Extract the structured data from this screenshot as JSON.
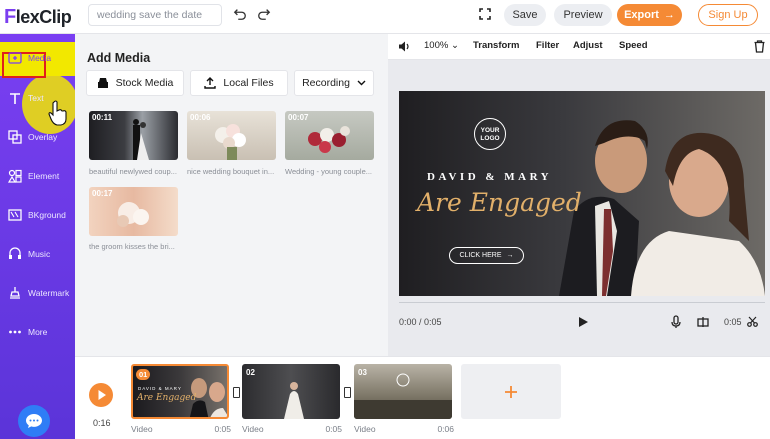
{
  "app": {
    "logo": "FlexClip"
  },
  "topbar": {
    "project_name": "wedding save the date",
    "save": "Save",
    "preview": "Preview",
    "export": "Export",
    "signup": "Sign Up"
  },
  "sidebar": {
    "items": [
      {
        "label": "Media",
        "icon": "media-icon"
      },
      {
        "label": "Text",
        "icon": "text-icon"
      },
      {
        "label": "Overlay",
        "icon": "overlay-icon"
      },
      {
        "label": "Element",
        "icon": "element-icon"
      },
      {
        "label": "BKground",
        "icon": "background-icon"
      },
      {
        "label": "Music",
        "icon": "music-icon"
      },
      {
        "label": "Watermark",
        "icon": "watermark-icon"
      },
      {
        "label": "More",
        "icon": "more-icon"
      }
    ]
  },
  "panel": {
    "title": "Add Media",
    "tabs": [
      "Stock Media",
      "Local Files",
      "Recording"
    ],
    "items": [
      {
        "duration": "00:11",
        "caption": "beautiful newlywed coup..."
      },
      {
        "duration": "00:06",
        "caption": "nice wedding bouquet in..."
      },
      {
        "duration": "00:07",
        "caption": "Wedding - young couple..."
      },
      {
        "duration": "00:17",
        "caption": "the groom kisses the bri..."
      }
    ]
  },
  "preview": {
    "zoom": "100%",
    "tools": [
      "Transform",
      "Filter",
      "Adjust",
      "Speed"
    ],
    "overlay": {
      "logo_line1": "YOUR",
      "logo_line2": "LOGO",
      "names": "DAVID & MARY",
      "headline": "Are Engaged",
      "cta": "CLICK HERE"
    },
    "current_time": "0:00 / 0:05",
    "clip_duration": "0:05"
  },
  "timeline": {
    "total": "0:16",
    "clips": [
      {
        "num": "01",
        "type": "Video",
        "duration": "0:05"
      },
      {
        "num": "02",
        "type": "Video",
        "duration": "0:05"
      },
      {
        "num": "03",
        "type": "Video",
        "duration": "0:06"
      }
    ]
  },
  "colors": {
    "accent": "#f58a35",
    "sidebar": "#6a3ae8",
    "highlight": "#f2e800"
  }
}
